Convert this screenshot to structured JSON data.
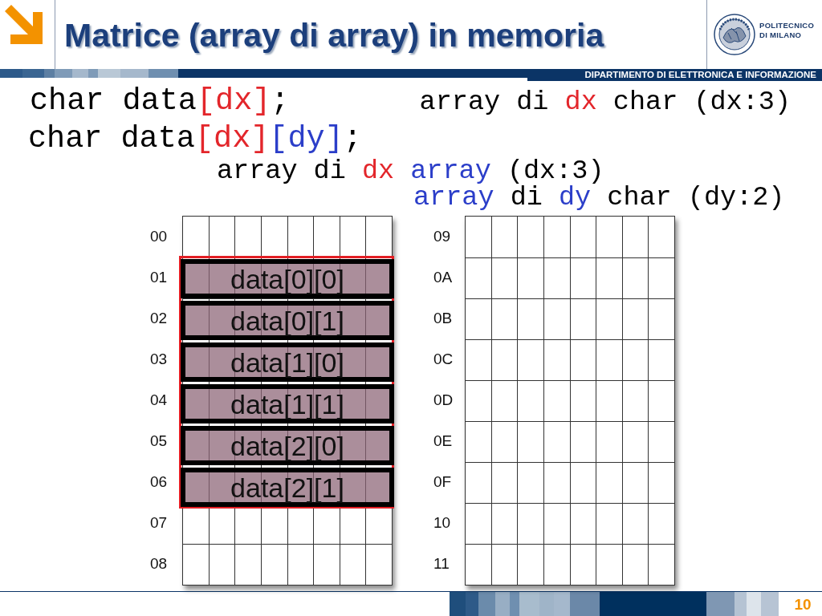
{
  "header": {
    "title": "Matrice (array di array) in memoria",
    "logo_lines": [
      "POLITECNICO",
      "DI MILANO"
    ],
    "department": "DIPARTIMENTO DI ELETTRONICA E INFORMAZIONE"
  },
  "code_lines": [
    [
      {
        "text": "char data",
        "color": "#000000"
      },
      {
        "text": "[dx]",
        "color": "#e3262b"
      },
      {
        "text": ";",
        "color": "#000000"
      }
    ],
    [
      {
        "text": "char data",
        "color": "#000000"
      },
      {
        "text": "[dx]",
        "color": "#e3262b"
      },
      {
        "text": "[dy]",
        "color": "#2b3ec9"
      },
      {
        "text": ";",
        "color": "#000000"
      }
    ]
  ],
  "notes": [
    [
      {
        "text": "array di ",
        "color": "#000000"
      },
      {
        "text": "dx",
        "color": "#e3262b"
      },
      {
        "text": " char (dx:3)",
        "color": "#000000"
      }
    ],
    [
      {
        "text": "array di ",
        "color": "#000000"
      },
      {
        "text": "dx",
        "color": "#e3262b"
      },
      {
        "text": " array",
        "color": "#2b3ec9"
      },
      {
        "text": " (dx:3)",
        "color": "#000000"
      }
    ],
    [
      {
        "text": "array",
        "color": "#2b3ec9"
      },
      {
        "text": " di ",
        "color": "#000000"
      },
      {
        "text": "dy",
        "color": "#2b3ec9"
      },
      {
        "text": " char (dy:2)",
        "color": "#000000"
      }
    ]
  ],
  "memory": [
    {
      "rows": [
        {
          "address": "00"
        },
        {
          "address": "01",
          "element": "data[0][0]"
        },
        {
          "address": "02",
          "element": "data[0][1]"
        },
        {
          "address": "03",
          "element": "data[1][0]"
        },
        {
          "address": "04",
          "element": "data[1][1]"
        },
        {
          "address": "05",
          "element": "data[2][0]"
        },
        {
          "address": "06",
          "element": "data[2][1]"
        },
        {
          "address": "07"
        },
        {
          "address": "08"
        }
      ]
    },
    {
      "rows": [
        {
          "address": "09"
        },
        {
          "address": "0A"
        },
        {
          "address": "0B"
        },
        {
          "address": "0C"
        },
        {
          "address": "0D"
        },
        {
          "address": "0E"
        },
        {
          "address": "0F"
        },
        {
          "address": "10"
        },
        {
          "address": "11"
        }
      ]
    }
  ],
  "slide_number": "10"
}
